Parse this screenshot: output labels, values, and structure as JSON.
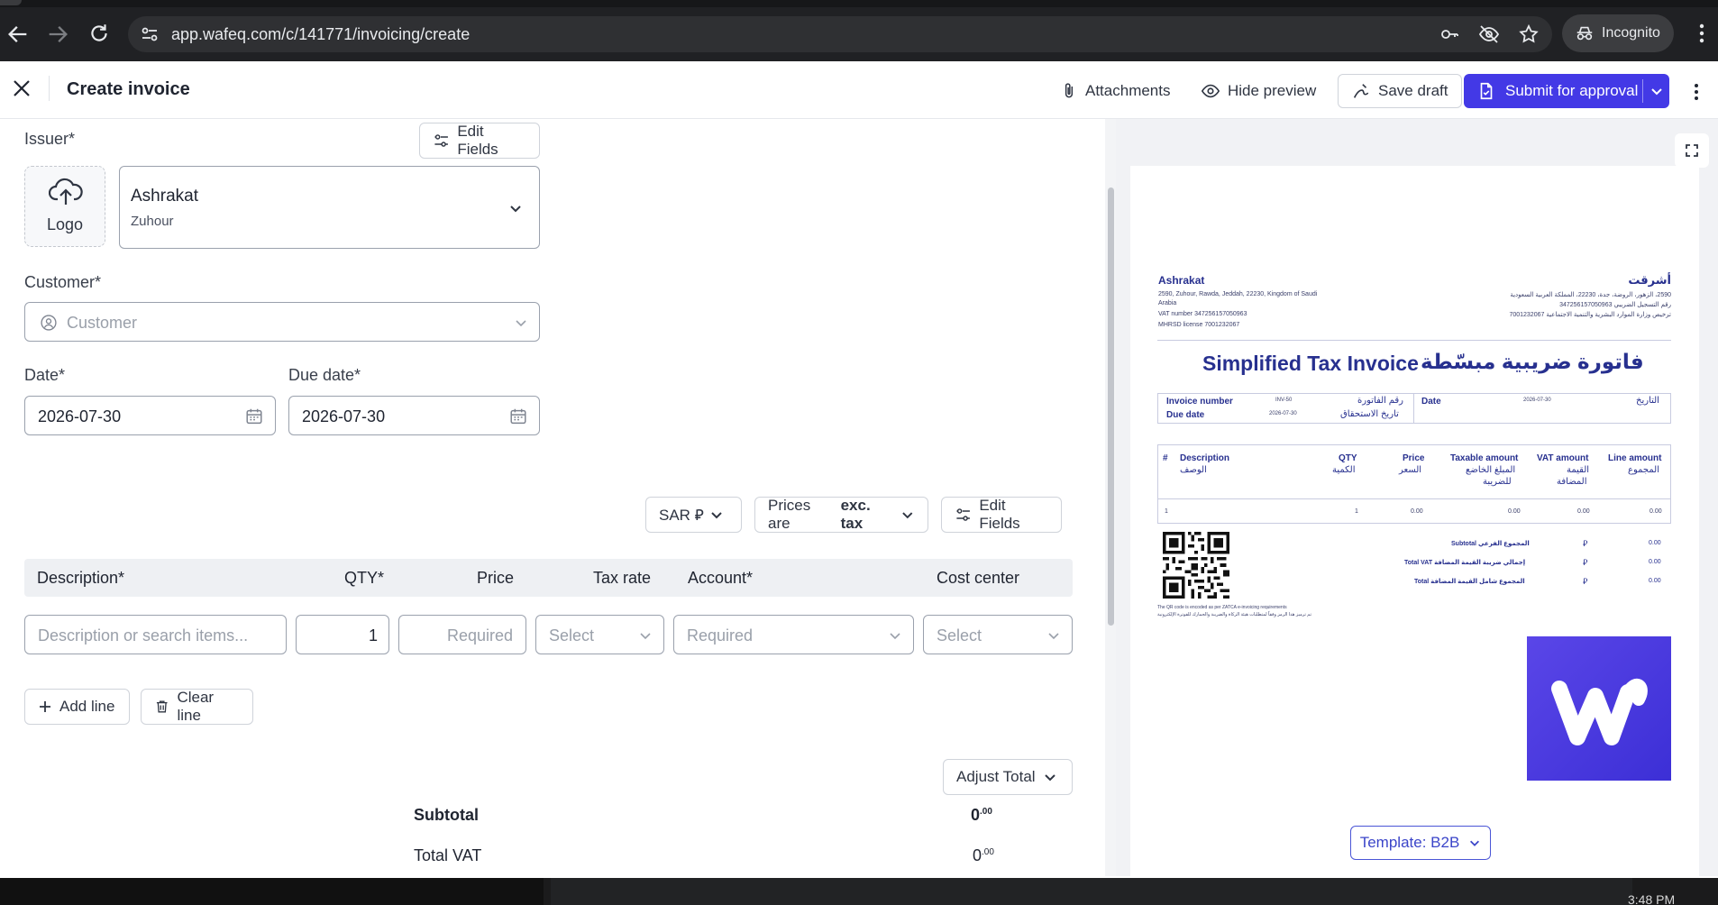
{
  "browser": {
    "url": "app.wafeq.com/c/141771/invoicing/create",
    "incognito_label": "Incognito"
  },
  "header": {
    "title": "Create invoice",
    "attachments_label": "Attachments",
    "hide_preview_label": "Hide preview",
    "save_draft_label": "Save draft",
    "submit_label": "Submit for approval"
  },
  "form": {
    "issuer_label": "Issuer*",
    "edit_fields_label": "Edit Fields",
    "logo_label": "Logo",
    "issuer_name": "Ashrakat",
    "issuer_sub": "Zuhour",
    "customer_label": "Customer*",
    "customer_placeholder": "Customer",
    "date_label": "Date*",
    "date_value": "2026-07-30",
    "due_date_label": "Due date*",
    "due_date_value": "2026-07-30",
    "currency": "SAR ⃁",
    "prices_prefix": "Prices are",
    "prices_mode": "exc. tax",
    "edit_fields_label_2": "Edit Fields"
  },
  "table": {
    "headers": [
      "Description*",
      "QTY*",
      "Price",
      "Tax rate",
      "Account*",
      "Cost center"
    ],
    "row": {
      "description_placeholder": "Description or search items...",
      "qty": "1",
      "price_placeholder": "Required",
      "tax_placeholder": "Select",
      "account_placeholder": "Required",
      "cost_center_placeholder": "Select"
    },
    "add_line_label": "Add line",
    "clear_line_label": "Clear line"
  },
  "totals": {
    "adjust_total_label": "Adjust Total",
    "subtotal_label": "Subtotal",
    "subtotal_int": "0",
    "subtotal_dec": ".00",
    "total_vat_label": "Total VAT",
    "total_vat_int": "0",
    "total_vat_dec": ".00"
  },
  "preview": {
    "company_en": "Ashrakat",
    "company_ar": "أشرقت",
    "address_en_1": "2590, Zuhour, Rawda, Jeddah, 22230, Kingdom of Saudi",
    "address_en_2": "Arabia",
    "vat_en": "VAT number 347256157050963",
    "mhrsd_en": "MHRSD license 7001232067",
    "address_ar": "2590، الزهور، الروضة، جدة، 22230، المملكة العربية السعودية",
    "vat_ar": "رقم التسجيل الضريبي 347256157050963",
    "mhrsd_ar": "ترخيص وزارة الموارد البشرية والتنمية الاجتماعية 7001232067",
    "title_en": "Simplified Tax Invoice",
    "title_ar": "فاتورة ضريبية مبسّطة",
    "invoice_number_label": "Invoice number",
    "invoice_number_value": "INV-50",
    "invoice_number_ar": "رقم الفاتورة",
    "due_date_label": "Due date",
    "due_date_value": "2026-07-30",
    "due_date_ar": "تاريخ الاستحقاق",
    "date_label": "Date",
    "date_value": "2026-07-30",
    "date_ar": "التاريخ",
    "col_hash": "#",
    "col_desc_en": "Description",
    "col_desc_ar": "الوصف",
    "col_qty_en": "QTY",
    "col_qty_ar": "الكمية",
    "col_price_en": "Price",
    "col_price_ar": "السعر",
    "col_taxable_en": "Taxable amount",
    "col_taxable_ar_1": "المبلغ الخاضع",
    "col_taxable_ar_2": "للضريبة",
    "col_vat_en": "VAT amount",
    "col_vat_ar_1": "القيمة",
    "col_vat_ar_2": "المضافة",
    "col_line_en": "Line amount",
    "col_line_ar": "المجموع",
    "row_num": "1",
    "row_qty": "1",
    "row_price": "0.00",
    "row_taxable": "0.00",
    "row_vat": "0.00",
    "row_line": "0.00",
    "subtotal_label": "Subtotal المجموع الفرعي",
    "total_vat_label": "Total VAT إجمالي ضريبة القيمة المضافة",
    "total_label": "Total المجموع شامل القيمة المضافة",
    "sum_currency": "⃁",
    "sum_value": "0.00",
    "qr_note_en": "The QR code is encoded as per ZATCA e-invoicing requirements",
    "qr_note_ar": "تم ترميز هذا الرمز وفقاً لمتطلبات هيئة الزكاة والضريبة والجمارك للفوترة الإلكترونية",
    "template_label": "Template: B2B"
  },
  "system": {
    "clock": "3:48 PM"
  },
  "colors": {
    "primary": "#4339e6",
    "preview_text": "#27308f"
  }
}
